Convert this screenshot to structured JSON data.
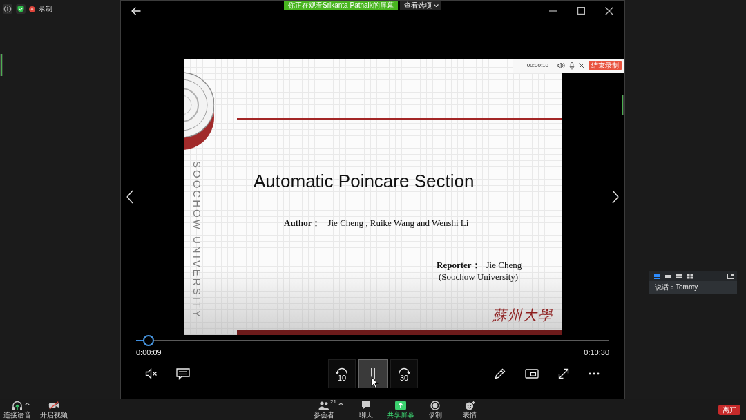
{
  "status_area": {
    "recording": true,
    "recording_label": "录制"
  },
  "share_banner": {
    "text": "你正在观看Srikanta Patnaik的屏幕",
    "view_options": "查看选项"
  },
  "player": {
    "slide": {
      "side_text": "SOOCHOW UNIVERSITY",
      "title": "Automatic Poincare Section",
      "author": {
        "label": "Author：",
        "names": "Jie Cheng , Ruike Wang and Wenshi Li"
      },
      "reporter": {
        "label": "Reporter：",
        "name": "Jie Cheng",
        "affiliation": "(Soochow University)"
      },
      "calligraphy": "蘇州大學"
    },
    "recorder": {
      "time": "00:00:10",
      "stop_button": "结束录制"
    },
    "progress": {
      "level": 0.026
    },
    "elapsed": "0:00:09",
    "duration": "0:10:30",
    "muted": true,
    "playing": true,
    "rewind_label": "10",
    "forward_label": "30"
  },
  "speaker_panel": {
    "views": [
      {
        "kind": "speaker",
        "selected": true
      },
      {
        "kind": "strip",
        "selected": false
      },
      {
        "kind": "list",
        "selected": false
      },
      {
        "kind": "grid",
        "selected": false
      }
    ],
    "speaking": "说话：Tommy"
  },
  "toolbar": {
    "audio": {
      "label": "连接语音",
      "menu": true
    },
    "video": {
      "label": "开启视频",
      "on": false
    },
    "center": [
      {
        "kind": "participants",
        "count": "21",
        "label": "参会者",
        "menu": true
      },
      {
        "kind": "chat",
        "label": "聊天",
        "menu": false
      },
      {
        "kind": "share",
        "label": "共享屏幕",
        "menu": false
      },
      {
        "kind": "record",
        "label": "录制",
        "menu": false
      },
      {
        "kind": "reactions",
        "label": "表情",
        "menu": false
      }
    ],
    "leave_button": "离开"
  }
}
